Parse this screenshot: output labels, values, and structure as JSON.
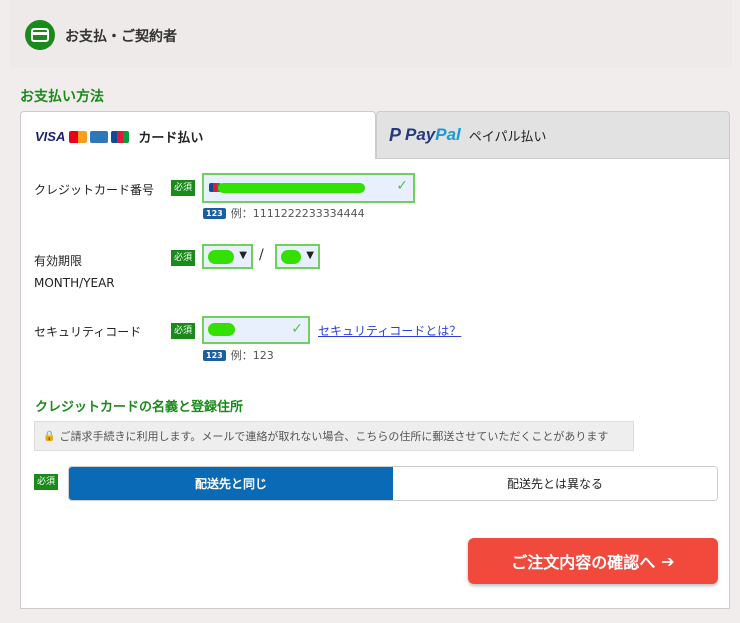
{
  "header": {
    "title": "お支払・ご契約者"
  },
  "section": {
    "title": "お支払い方法"
  },
  "tabs": {
    "card": {
      "label": "カード払い",
      "brand_visa": "VISA"
    },
    "paypal": {
      "logo_p": "P",
      "logo_pay": "Pay",
      "logo_pal": "Pal",
      "label": "ペイパル払い"
    }
  },
  "form": {
    "required_label": "必須",
    "card_number": {
      "label": "クレジットカード番号",
      "hint_badge": "123",
      "hint": "例：1111222233334444"
    },
    "expiry": {
      "label": "有効期限",
      "sub_label": "MONTH/YEAR",
      "separator": "/"
    },
    "security": {
      "label": "セキュリティコード",
      "link": "セキュリティコードとは？",
      "hint_badge": "123",
      "hint": "例：123"
    }
  },
  "holder": {
    "title": "クレジットカードの名義と登録住所",
    "notice": "ご請求手続きに利用します。メールで連絡が取れない場合、こちらの住所に郵送させていただくことがあります",
    "option_same": "配送先と同じ",
    "option_diff": "配送先とは異なる"
  },
  "confirm_button": {
    "label": "ご注文内容の確認へ",
    "arrow": "➔"
  },
  "colors": {
    "accent_green": "#1a8a1a",
    "primary_blue": "#0a6ab5",
    "cta_red": "#f14a3c"
  }
}
